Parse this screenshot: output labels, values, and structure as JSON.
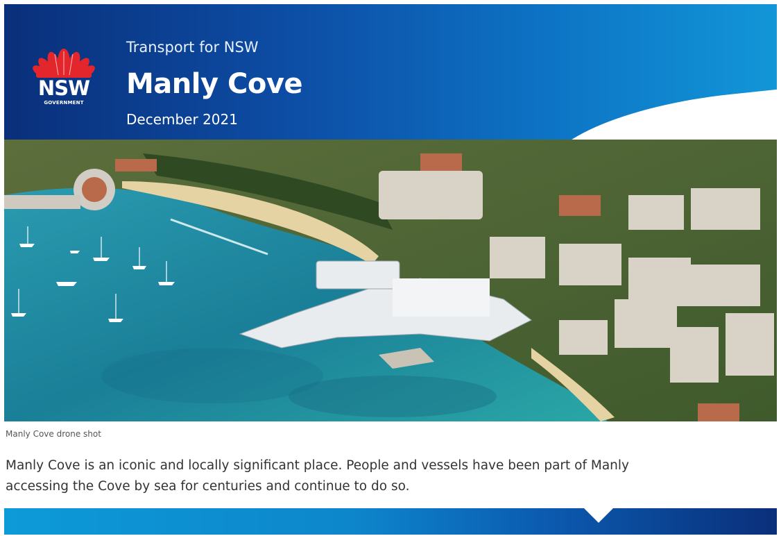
{
  "header": {
    "logo": {
      "word": "NSW",
      "sub": "GOVERNMENT",
      "icon": "waratah-icon"
    },
    "organisation": "Transport for NSW",
    "title": "Manly Cove",
    "date": "December 2021"
  },
  "photo": {
    "caption": "Manly Cove drone shot"
  },
  "body": {
    "line1": "Manly Cove is an iconic and locally significant place. People and vessels have been part of Manly",
    "line2": "accessing the Cove by sea for centuries and continue to do so."
  },
  "colors": {
    "header_dark": "#0a2f7a",
    "header_light": "#1296d8",
    "waratah_red": "#e3262b",
    "sea": "#1f8ea3"
  }
}
